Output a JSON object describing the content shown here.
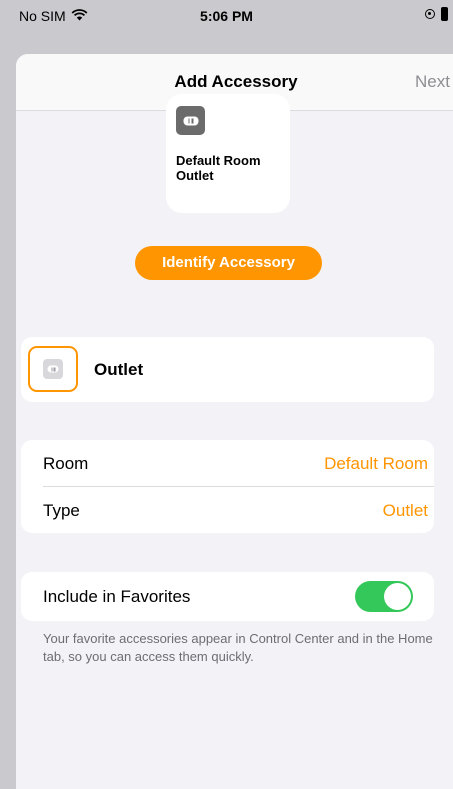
{
  "status_bar": {
    "carrier": "No SIM",
    "time": "5:06 PM",
    "wifi_icon": "wifi-icon",
    "orientation_lock_icon": "orientation-lock-icon",
    "battery_icon": "battery-icon"
  },
  "nav": {
    "title": "Add Accessory",
    "next_label": "Next"
  },
  "tile": {
    "name": "Default Room Outlet",
    "icon": "outlet-icon"
  },
  "identify_button": "Identify Accessory",
  "accessory_row": {
    "name": "Outlet",
    "icon": "outlet-icon"
  },
  "details": [
    {
      "label": "Room",
      "value": "Default Room"
    },
    {
      "label": "Type",
      "value": "Outlet"
    }
  ],
  "favorites": {
    "label": "Include in Favorites",
    "on": true,
    "footnote": "Your favorite accessories appear in Control Center and in the Home tab, so you can access them quickly."
  },
  "colors": {
    "accent": "#ff9500",
    "toggle_on": "#34c759",
    "background": "#f2f2f7"
  }
}
